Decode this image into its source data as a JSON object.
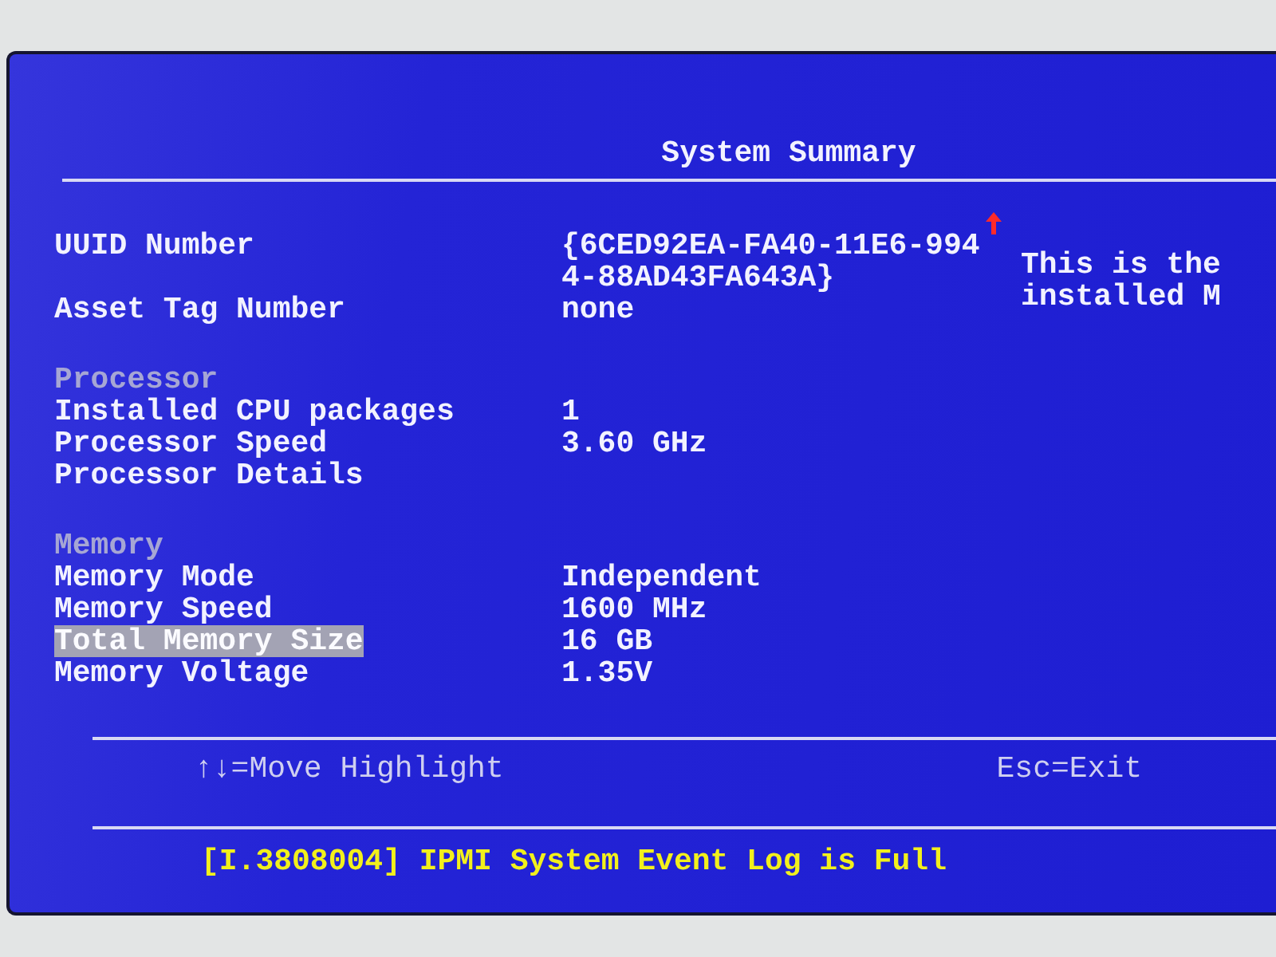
{
  "title": "System Summary",
  "groups": [
    {
      "items": [
        {
          "label": "UUID Number",
          "value_lines": [
            "{6CED92EA-FA40-11E6-994",
            "4-88AD43FA643A}"
          ],
          "selected": false
        },
        {
          "label": "Asset Tag Number",
          "value_lines": [
            "none"
          ],
          "selected": false
        }
      ]
    },
    {
      "heading": "Processor",
      "items": [
        {
          "label": "Installed CPU packages",
          "value_lines": [
            "1"
          ],
          "selected": false
        },
        {
          "label": "Processor Speed",
          "value_lines": [
            "3.60 GHz"
          ],
          "selected": false
        },
        {
          "label": "Processor Details",
          "selected": false
        }
      ]
    },
    {
      "heading": "Memory",
      "items": [
        {
          "label": "Memory Mode",
          "value_lines": [
            "Independent"
          ],
          "selected": false
        },
        {
          "label": "Memory Speed",
          "value_lines": [
            "1600 MHz"
          ],
          "selected": false
        },
        {
          "label": "Total Memory Size",
          "value_lines": [
            "16 GB"
          ],
          "selected": true
        },
        {
          "label": "Memory Voltage",
          "value_lines": [
            "1.35V"
          ],
          "selected": false
        }
      ]
    }
  ],
  "help_text": [
    "This is the",
    "installed M"
  ],
  "key_hints": [
    "↑↓=Move Highlight",
    "Esc=Exit"
  ],
  "status_message": "[I.3808004] IPMI System Event Log is Full"
}
